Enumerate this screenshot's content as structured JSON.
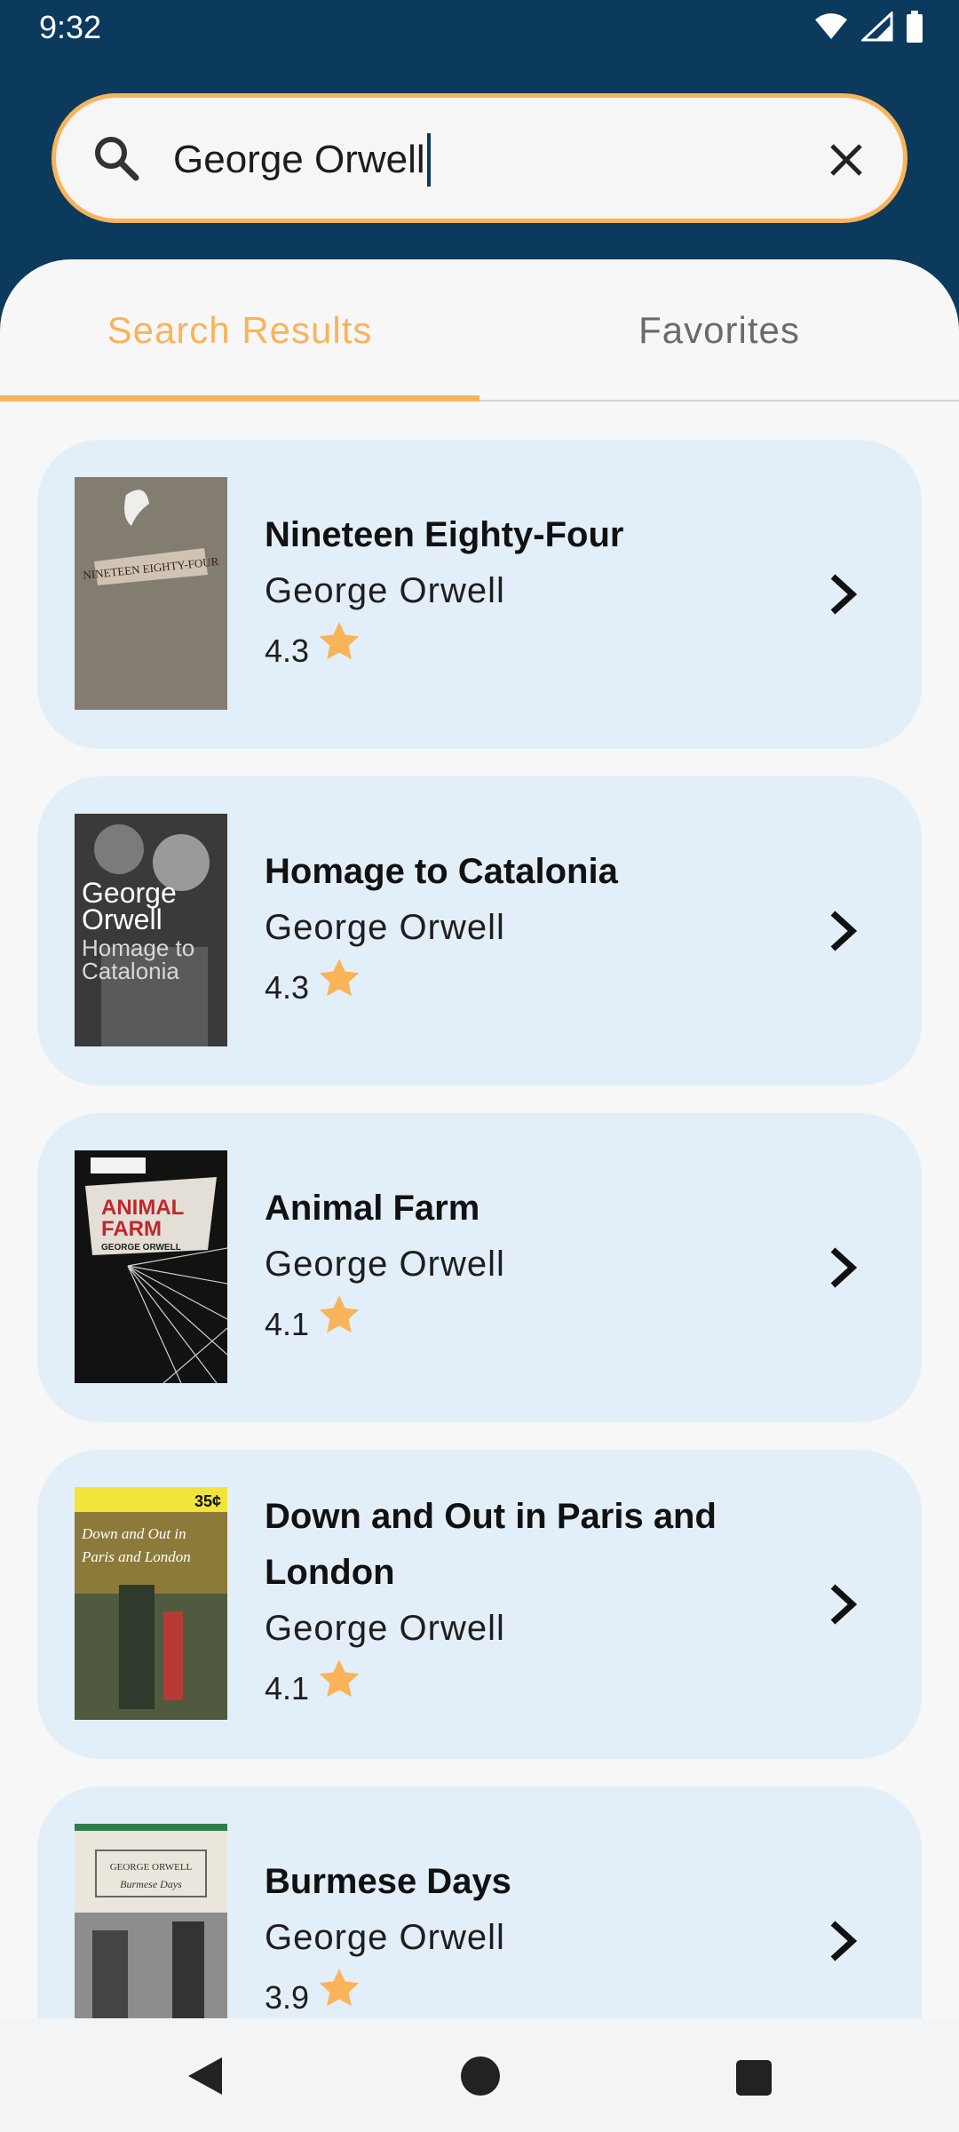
{
  "status_bar": {
    "time": "9:32"
  },
  "search": {
    "query": "George Orwell"
  },
  "tabs": [
    {
      "label": "Search Results",
      "selected": true
    },
    {
      "label": "Favorites",
      "selected": false
    }
  ],
  "results": [
    {
      "title": "Nineteen Eighty-Four",
      "author": "George Orwell",
      "rating": "4.3"
    },
    {
      "title": "Homage to Catalonia",
      "author": "George Orwell",
      "rating": "4.3"
    },
    {
      "title": "Animal Farm",
      "author": "George Orwell",
      "rating": "4.1"
    },
    {
      "title": "Down and Out in Paris and London",
      "author": "George Orwell",
      "rating": "4.1"
    },
    {
      "title": "Burmese Days",
      "author": "George Orwell",
      "rating": "3.9"
    }
  ],
  "covers": {
    "nineteen_eighty_four": "NINETEEN EIGHTY-FOUR",
    "homage_line1": "George",
    "homage_line2": "Orwell",
    "homage_line3": "Homage to",
    "homage_line4": "Catalonia",
    "animal_line1": "ANIMAL",
    "animal_line2": "FARM",
    "animal_author": "GEORGE ORWELL",
    "down_price": "35¢",
    "down_line1": "Down and Out in",
    "down_line2": "Paris and London",
    "burmese_author": "GEORGE ORWELL",
    "burmese_title": "Burmese Days"
  },
  "colors": {
    "primary": "#0b3a5c",
    "accent": "#f9b45a",
    "card": "#e3eff8"
  },
  "icons": {
    "search": "search-icon",
    "clear": "close-icon",
    "star": "star-icon",
    "chevron": "chevron-right-icon"
  }
}
